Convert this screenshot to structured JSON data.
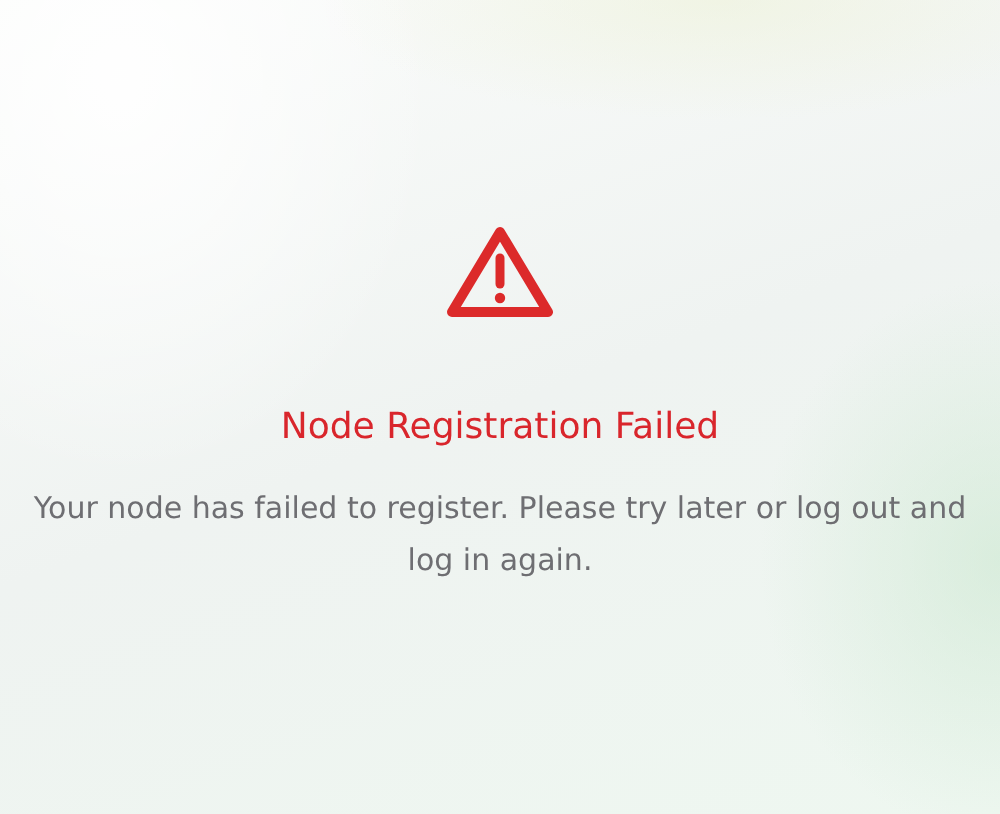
{
  "error": {
    "title": "Node Registration Failed",
    "message": "Your node has failed to register. Please try later or log out and log in again."
  }
}
